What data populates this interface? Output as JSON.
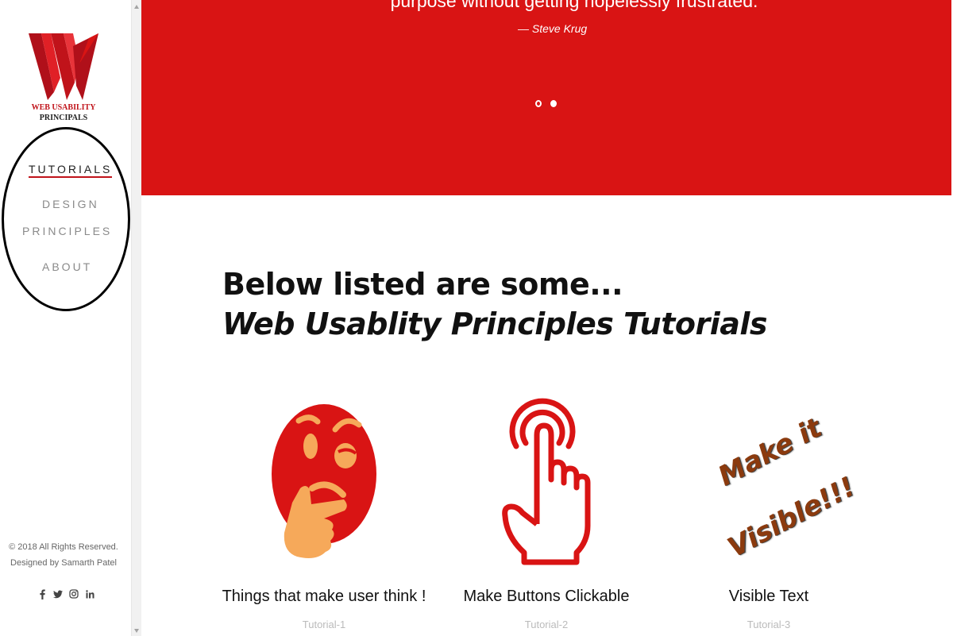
{
  "logo": {
    "line1": "WEB USABILITY",
    "line2": "PRINCIPALS"
  },
  "nav": {
    "items": [
      {
        "label": "TUTORIALS",
        "active": true
      },
      {
        "label": "DESIGN"
      },
      {
        "label": "PRINCIPLES"
      },
      {
        "label": "ABOUT"
      }
    ]
  },
  "footer": {
    "copyright": "© 2018 All Rights Reserved.",
    "credit": "Designed by Samarth Patel",
    "social_icons": [
      "facebook-icon",
      "twitter-icon",
      "instagram-icon",
      "linkedin-icon"
    ]
  },
  "hero": {
    "quote_line": "purpose without getting hopelessly frustrated.",
    "author": "— Steve Krug",
    "slides": 2,
    "active_slide": 2
  },
  "heading": {
    "line1": "Below listed are some...",
    "line2": "Web Usablity Principles Tutorials"
  },
  "cards": [
    {
      "title": "Things that make user think !",
      "subtitle": "Tutorial-1",
      "image": "thinking-face-icon"
    },
    {
      "title": "Make Buttons Clickable",
      "subtitle": "Tutorial-2",
      "image": "tap-hand-icon"
    },
    {
      "title": "Visible Text",
      "subtitle": "Tutorial-3",
      "image": "make-it-visible-art",
      "art_text": [
        "Make it",
        "Visible!!!"
      ]
    }
  ],
  "colors": {
    "accent": "#d91414",
    "brown_text": "#8b3a0e",
    "sidebar_bg": "#ffffff"
  }
}
